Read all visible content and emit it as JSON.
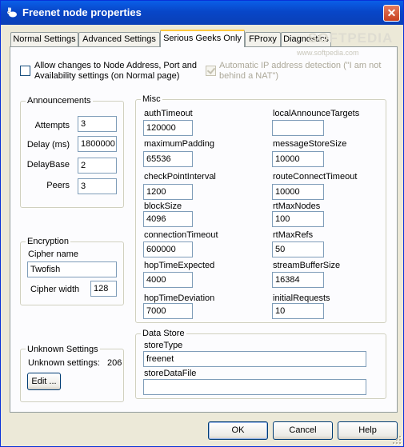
{
  "window": {
    "title": "Freenet node properties",
    "close_glyph": "✕"
  },
  "tabs": [
    {
      "label": "Normal Settings"
    },
    {
      "label": "Advanced Settings"
    },
    {
      "label": "Serious Geeks Only",
      "active": true
    },
    {
      "label": "FProxy"
    },
    {
      "label": "Diagnostics"
    }
  ],
  "watermark": {
    "brand": "SOFTPEDIA",
    "url": "www.softpedia.com"
  },
  "options": {
    "allow_changes": {
      "label": "Allow changes to Node Address, Port and Availability settings (on Normal page)",
      "checked": false
    },
    "auto_ip": {
      "label": "Automatic IP address detection (\"I am not behind a NAT\")",
      "checked": true,
      "enabled": false
    }
  },
  "announcements": {
    "title": "Announcements",
    "fields": [
      {
        "label": "Attempts",
        "value": "3"
      },
      {
        "label": "Delay (ms)",
        "value": "1800000"
      },
      {
        "label": "DelayBase",
        "value": "2"
      },
      {
        "label": "Peers",
        "value": "3"
      }
    ]
  },
  "encryption": {
    "title": "Encryption",
    "cipher_name_label": "Cipher name",
    "cipher_name": "Twofish",
    "cipher_width_label": "Cipher width",
    "cipher_width": "128"
  },
  "unknown": {
    "title": "Unknown Settings",
    "label": "Unknown settings:",
    "count": "206",
    "edit_button": "Edit ..."
  },
  "misc": {
    "title": "Misc",
    "left": [
      {
        "label": "authTimeout",
        "value": "120000"
      },
      {
        "label": "maximumPadding",
        "value": "65536"
      },
      {
        "label": "checkPointInterval",
        "value": "1200"
      },
      {
        "label": "blockSize",
        "value": "4096"
      },
      {
        "label": "connectionTimeout",
        "value": "600000"
      },
      {
        "label": "hopTimeExpected",
        "value": "4000"
      },
      {
        "label": "hopTimeDeviation",
        "value": "7000"
      }
    ],
    "right": [
      {
        "label": "localAnnounceTargets",
        "value": ""
      },
      {
        "label": "messageStoreSize",
        "value": "10000"
      },
      {
        "label": "routeConnectTimeout",
        "value": "10000"
      },
      {
        "label": "rtMaxNodes",
        "value": "100"
      },
      {
        "label": "rtMaxRefs",
        "value": "50"
      },
      {
        "label": "streamBufferSize",
        "value": "16384"
      },
      {
        "label": "initialRequests",
        "value": "10"
      }
    ]
  },
  "datastore": {
    "title": "Data Store",
    "store_type_label": "storeType",
    "store_type": "freenet",
    "store_file_label": "storeDataFile",
    "store_file": ""
  },
  "buttons": {
    "ok": "OK",
    "cancel": "Cancel",
    "help": "Help"
  }
}
